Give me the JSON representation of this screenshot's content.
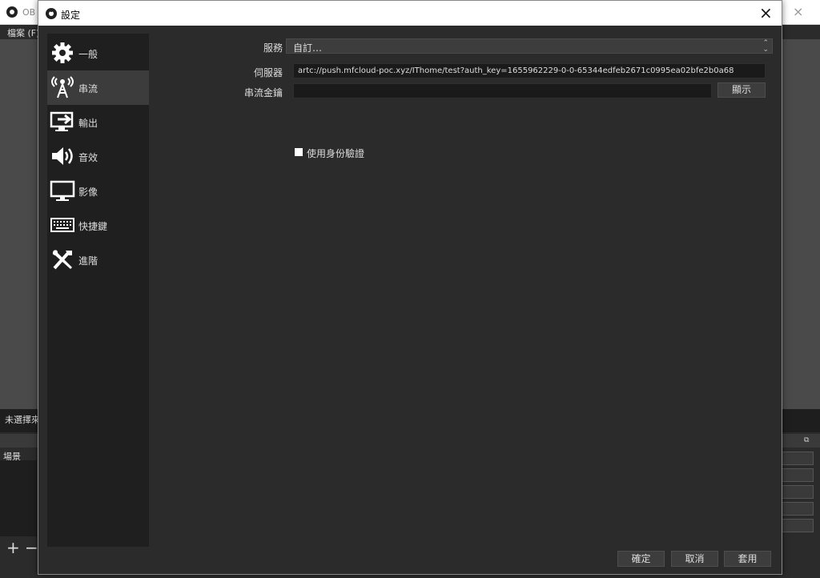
{
  "background": {
    "title": "OB",
    "menu_file": "檔案 (F)",
    "scenes_header": "未選擇來",
    "scenes_title": "場景",
    "add_symbol": "+",
    "remove_symbol": "−",
    "close_symbol": "×"
  },
  "dialog": {
    "title": "設定",
    "close_symbol": "×"
  },
  "sidebar": {
    "items": [
      {
        "label": "一般",
        "icon": "gear-icon"
      },
      {
        "label": "串流",
        "icon": "broadcast-icon"
      },
      {
        "label": "輸出",
        "icon": "output-icon"
      },
      {
        "label": "音效",
        "icon": "speaker-icon"
      },
      {
        "label": "影像",
        "icon": "monitor-icon"
      },
      {
        "label": "快捷鍵",
        "icon": "keyboard-icon"
      },
      {
        "label": "進階",
        "icon": "tools-icon"
      }
    ]
  },
  "stream": {
    "service_label": "服務",
    "service_value": "自訂…",
    "server_label": "伺服器",
    "server_value": "artc://push.mfcloud-poc.xyz/IThome/test?auth_key=1655962229-0-0-65344edfeb2671c0995ea02bfe2b0a68",
    "key_label": "串流金鑰",
    "key_value": "",
    "show_button": "顯示",
    "auth_checkbox_label": "使用身份驗證",
    "auth_checked": false
  },
  "footer": {
    "ok": "確定",
    "cancel": "取消",
    "apply": "套用"
  },
  "colors": {
    "dialog_bg": "#2b2b2b",
    "sidebar_bg": "#1f1f1f",
    "active_item": "#3c3c3c",
    "input_bg": "#1a1a1a"
  }
}
